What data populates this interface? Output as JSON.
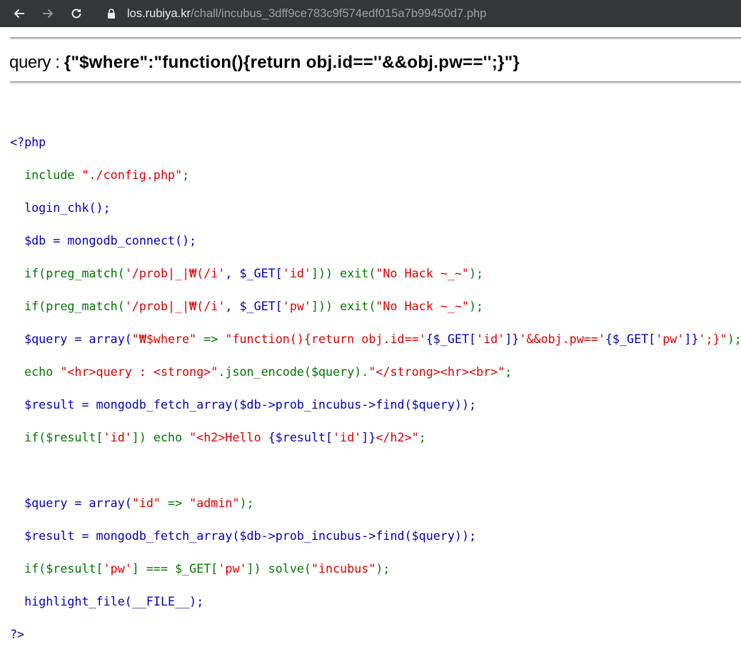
{
  "browser": {
    "url_host": "los.rubiya.kr",
    "url_path": "/chall/incubus_3dff9ce783c9f574edf015a7b99450d7.php",
    "icons": [
      "back-arrow-icon",
      "forward-arrow-icon",
      "reload-icon",
      "lock-icon"
    ]
  },
  "query": {
    "label": "query : ",
    "value": "{\"$where\":\"function(){return obj.id==''&&obj.pw=='';}\"}"
  },
  "code": {
    "open_tag": "<?php",
    "l1a": "include ",
    "l1b": "\"./config.php\"",
    "l1c": ";",
    "l2": "login_chk();",
    "l3": "$db = mongodb_connect();",
    "l4a": "if(preg_match(",
    "l4b": "'/prob|_|₩(/i'",
    "l4c": ", $_GET[",
    "l4d": "'id'",
    "l4e": "])) exit(",
    "l4f": "\"No Hack ~_~\"",
    "l4g": ");",
    "l5a": "if(preg_match(",
    "l5b": "'/prob|_|₩(/i'",
    "l5c": ", $_GET[",
    "l5d": "'pw'",
    "l5e": "])) exit(",
    "l5f": "\"No Hack ~_~\"",
    "l5g": ");",
    "l6a": "$query = array(",
    "l6b": "\"₩$where\"",
    "l6c": " => ",
    "l6d": "\"function(){return obj.id=='",
    "l6e": "{$_GET[",
    "l6f": "'id'",
    "l6g": "]}",
    "l6h": "'&&obj.pw=='",
    "l6i": "{$_GET[",
    "l6j": "'pw'",
    "l6k": "]}",
    "l6l": "';}\"",
    "l6m": ");",
    "l7a": "echo ",
    "l7b": "\"<hr>query : <strong>\"",
    "l7c": ".json_encode($query).",
    "l7d": "\"</strong><hr><br>\"",
    "l7e": ";",
    "l8": "$result = mongodb_fetch_array($db->prob_incubus->find($query));",
    "l9a": "if($result[",
    "l9b": "'id'",
    "l9c": "]) echo ",
    "l9d": "\"<h2>Hello ",
    "l9e": "{$result[",
    "l9f": "'id'",
    "l9g": "]}",
    "l9h": "</h2>\"",
    "l9i": ";",
    "l10a": "$query = array(",
    "l10b": "\"id\"",
    "l10c": " => ",
    "l10d": "\"admin\"",
    "l10e": ");",
    "l11": "$result = mongodb_fetch_array($db->prob_incubus->find($query));",
    "l12a": "if($result[",
    "l12b": "'pw'",
    "l12c": "] === $_GET[",
    "l12d": "'pw'",
    "l12e": "]) solve(",
    "l12f": "\"incubus\"",
    "l12g": ");",
    "l13": "highlight_file(__FILE__);",
    "close_tag": "?>"
  }
}
